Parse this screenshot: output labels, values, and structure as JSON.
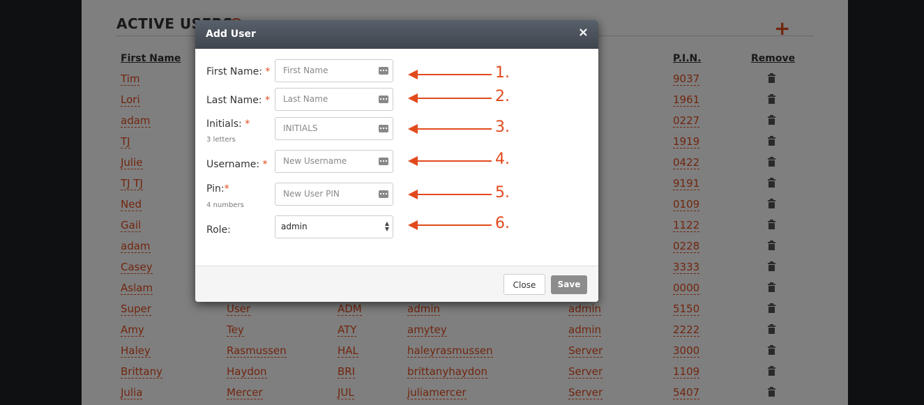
{
  "page": {
    "section_title": "ACTIVE USERS",
    "columns": {
      "first_name": "First Name",
      "pin": "P.I.N.",
      "remove": "Remove"
    },
    "rows": [
      {
        "first": "Tim",
        "last": "",
        "initials": "",
        "username": "",
        "role": "",
        "pin": "9037"
      },
      {
        "first": "Lori",
        "last": "",
        "initials": "",
        "username": "",
        "role": "",
        "pin": "1961"
      },
      {
        "first": "adam",
        "last": "",
        "initials": "",
        "username": "",
        "role": "",
        "pin": "0227"
      },
      {
        "first": "TJ",
        "last": "",
        "initials": "",
        "username": "",
        "role": "",
        "pin": "1919"
      },
      {
        "first": "Julie",
        "last": "",
        "initials": "",
        "username": "",
        "role": "",
        "pin": "0422"
      },
      {
        "first": "TJ TJ",
        "last": "",
        "initials": "",
        "username": "",
        "role": "",
        "pin": "9191"
      },
      {
        "first": "Ned",
        "last": "",
        "initials": "",
        "username": "",
        "role": "",
        "pin": "0109"
      },
      {
        "first": "Gail",
        "last": "",
        "initials": "",
        "username": "",
        "role": "",
        "pin": "1122"
      },
      {
        "first": "adam",
        "last": "",
        "initials": "",
        "username": "",
        "role": "",
        "pin": "0228"
      },
      {
        "first": "Casey",
        "last": "",
        "initials": "",
        "username": "",
        "role": "",
        "pin": "3333"
      },
      {
        "first": "Aslam",
        "last": "",
        "initials": "",
        "username": "",
        "role": "",
        "pin": "0000"
      },
      {
        "first": "Super",
        "last": "User",
        "initials": "ADM",
        "username": "admin",
        "role": "admin",
        "pin": "5150"
      },
      {
        "first": "Amy",
        "last": "Tey",
        "initials": "ATY",
        "username": "amytey",
        "role": "admin",
        "pin": "2222"
      },
      {
        "first": "Haley",
        "last": "Rasmussen",
        "initials": "HAL",
        "username": "haleyrasmussen",
        "role": "Server",
        "pin": "3000"
      },
      {
        "first": "Brittany",
        "last": "Haydon",
        "initials": "BRI",
        "username": "brittanyhaydon",
        "role": "Server",
        "pin": "1109"
      },
      {
        "first": "Julia",
        "last": "Mercer",
        "initials": "JUL",
        "username": "juliamercer",
        "role": "Server",
        "pin": "5407"
      }
    ]
  },
  "modal": {
    "title": "Add User",
    "close_glyph": "×",
    "fields": {
      "first_name": {
        "label": "First Name:",
        "required": "*",
        "placeholder": "First Name"
      },
      "last_name": {
        "label": "Last Name:",
        "required": "*",
        "placeholder": "Last Name"
      },
      "initials": {
        "label": "Initials:",
        "required": "*",
        "hint": "3 letters",
        "placeholder": "INITIALS"
      },
      "username": {
        "label": "Username:",
        "required": "*",
        "placeholder": "New Username"
      },
      "pin": {
        "label": "Pin:",
        "required": "*",
        "hint": "4 numbers",
        "placeholder": "New User PIN"
      },
      "role": {
        "label": "Role:",
        "value": "admin"
      }
    },
    "buttons": {
      "close": "Close",
      "save": "Save"
    }
  },
  "annotations": [
    "1.",
    "2.",
    "3.",
    "4.",
    "5.",
    "6."
  ],
  "colors": {
    "accent": "#e24a1c",
    "header": "#4a515b",
    "save_disabled": "#8c8c8c"
  }
}
